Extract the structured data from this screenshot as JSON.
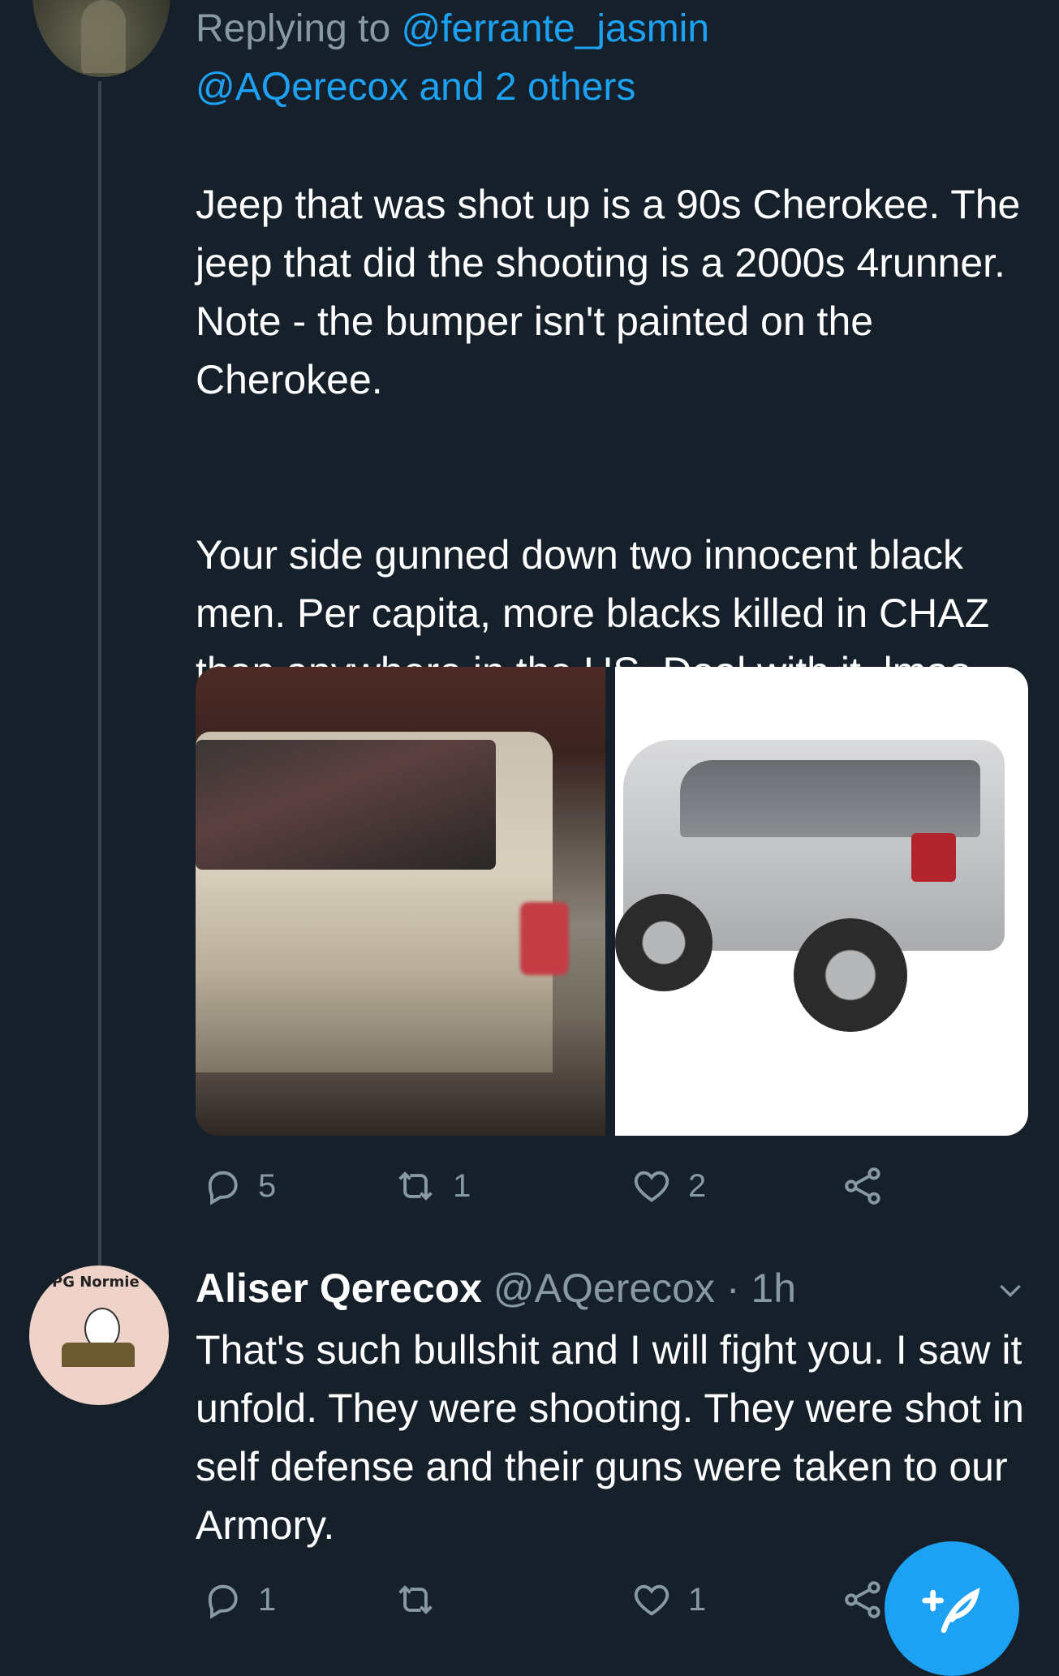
{
  "tweet1": {
    "reply_prefix": "Replying to ",
    "reply_mention_1": "@ferrante_jasmin",
    "reply_mention_2": "@AQerecox and 2 others",
    "text_p1": "Jeep that was shot up is a 90s Cherokee. The jeep that did the shooting is a 2000s 4runner. Note - the bumper isn't painted on the Cherokee.",
    "text_p2": "Your side gunned down two innocent black men. Per capita, more blacks killed in CHAZ than anywhere in the US. Deal with it, lmao",
    "reply_count": "5",
    "retweet_count": "1",
    "like_count": "2"
  },
  "tweet2": {
    "display_name": "Aliser Qerecox",
    "handle": "@AQerecox",
    "separator": " · ",
    "time": "1h",
    "text": "That's such bullshit and I will fight you. I saw it unfold. They were shooting. They were shot in self defense and their guns were taken to our Armory.",
    "reply_count": "1",
    "retweet_count": "",
    "like_count": "1",
    "avatar_caption": "PG Normie"
  },
  "colors": {
    "background": "#15202b",
    "accent": "#1da1f2",
    "muted": "#8899a6",
    "text": "#ffffff"
  },
  "icons": {
    "reply": "reply-icon",
    "retweet": "retweet-icon",
    "like": "heart-icon",
    "share": "share-icon",
    "more": "chevron-down-icon",
    "compose": "compose-tweet-icon"
  }
}
